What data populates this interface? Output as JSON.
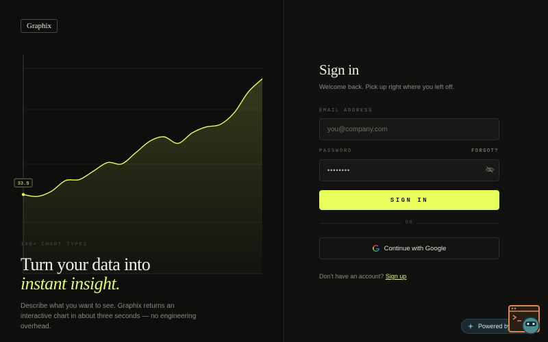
{
  "brand": {
    "logo": "Graphix"
  },
  "hero": {
    "eyebrow": "140+ CHART TYPES",
    "headline_line1": "Turn your data into",
    "headline_line2": "instant insight.",
    "description": "Describe what you want to see. Graphix returns an interactive chart in about three seconds — no engineering overhead."
  },
  "chart_data": {
    "type": "area",
    "start_label": "33.9",
    "values": [
      33.9,
      33.2,
      35.1,
      39.0,
      39.4,
      42.5,
      45.6,
      45.1,
      49.2,
      53.4,
      55.0,
      52.6,
      56.4,
      58.6,
      59.5,
      63.8,
      71.4,
      76.2
    ]
  },
  "signin": {
    "title": "Sign in",
    "subtitle": "Welcome back. Pick up right where you left off.",
    "email_label": "EMAIL ADDRESS",
    "email_placeholder": "you@company.com",
    "password_label": "PASSWORD",
    "forgot": "FORGOT?",
    "password_value": "••••••••",
    "submit": "SIGN IN",
    "divider": "OR",
    "google": "Continue with Google",
    "no_account": "Don't have an account?",
    "signup": "Sign up"
  },
  "badge": {
    "text": "Powered by Netlify"
  },
  "colors": {
    "accent": "#e8ff5c",
    "background": "#0c0c0b",
    "border": "#2c2c29"
  },
  "icons": {
    "eye": "eye-off-icon",
    "google": "google-icon",
    "badge": "sparkle-icon",
    "mascot": "robot-mascot-icon"
  }
}
